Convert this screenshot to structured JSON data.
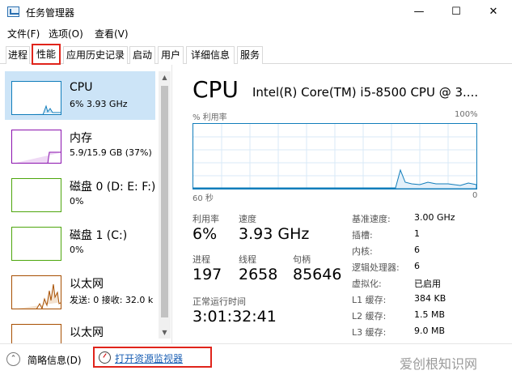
{
  "window": {
    "title": "任务管理器",
    "minimize": "—",
    "maximize": "☐",
    "close": "✕"
  },
  "menu": {
    "file": "文件(F)",
    "options": "选项(O)",
    "view": "查看(V)"
  },
  "tabs": [
    "进程",
    "性能",
    "应用历史记录",
    "启动",
    "用户",
    "详细信息",
    "服务"
  ],
  "active_tab": "性能",
  "sidebar": {
    "items": [
      {
        "name": "CPU",
        "sub": "6% 3.93 GHz",
        "graph": "cpu"
      },
      {
        "name": "内存",
        "sub": "5.9/15.9 GB (37%)",
        "graph": "memory"
      },
      {
        "name": "磁盘 0 (D: E: F:)",
        "sub": "0%",
        "graph": "disk"
      },
      {
        "name": "磁盘 1 (C:)",
        "sub": "0%",
        "graph": "disk"
      },
      {
        "name": "以太网",
        "sub": "发送: 0 接收: 32.0 k",
        "graph": "ethernet"
      },
      {
        "name": "以太网",
        "sub": "",
        "graph": "ethernet"
      }
    ]
  },
  "main": {
    "title": "CPU",
    "model": "Intel(R) Core(TM) i5-8500 CPU @ 3....",
    "graph_top_left": "% 利用率",
    "graph_top_right": "100%",
    "graph_bottom_left": "60 秒",
    "graph_bottom_right": "0",
    "utilization_label": "利用率",
    "utilization_value": "6%",
    "speed_label": "速度",
    "speed_value": "3.93 GHz",
    "processes_label": "进程",
    "processes_value": "197",
    "threads_label": "线程",
    "threads_value": "2658",
    "handles_label": "句柄",
    "handles_value": "85646",
    "uptime_label": "正常运行时间",
    "uptime_value": "3:01:32:41",
    "details": [
      {
        "label": "基准速度:",
        "value": "3.00 GHz"
      },
      {
        "label": "插槽:",
        "value": "1"
      },
      {
        "label": "内核:",
        "value": "6"
      },
      {
        "label": "逻辑处理器:",
        "value": "6"
      },
      {
        "label": "虚拟化:",
        "value": "已启用"
      },
      {
        "label": "L1 缓存:",
        "value": "384 KB"
      },
      {
        "label": "L2 缓存:",
        "value": "1.5 MB"
      },
      {
        "label": "L3 缓存:",
        "value": "9.0 MB"
      }
    ]
  },
  "footer": {
    "fewer_details": "简略信息(D)",
    "open_resource_monitor": "打开资源监视器"
  },
  "watermark": "爱创根知识网",
  "colors": {
    "cpu": "#117dbb",
    "memory": "#8b12ae",
    "disk": "#4da60c",
    "ethernet": "#a74f01",
    "highlight": "#e0241b",
    "selected": "#cce4f7"
  }
}
